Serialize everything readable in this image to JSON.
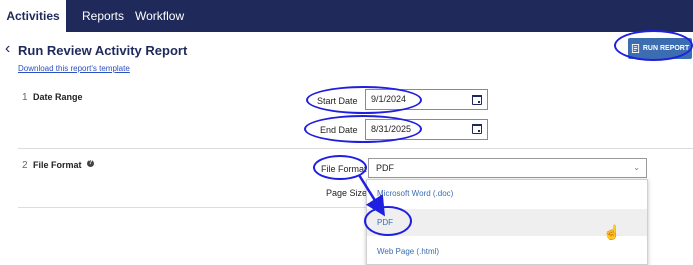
{
  "topnav": {
    "tabs": [
      "Activities",
      "Reports",
      "Workflow"
    ]
  },
  "header": {
    "title": "Run Review Activity Report",
    "template_link": "Download this report's template",
    "run_button": "RUN REPORT"
  },
  "steps": [
    {
      "number": "1",
      "label": "Date Range"
    },
    {
      "number": "2",
      "label": "File Format"
    }
  ],
  "date_range": {
    "start_label": "Start Date",
    "start_value": "9/1/2024",
    "end_label": "End Date",
    "end_value": "8/31/2025"
  },
  "file_format": {
    "label": "File Format",
    "value": "PDF",
    "page_size_label": "Page Size",
    "options": [
      "Microsoft Word (.doc)",
      "PDF",
      "Web Page (.html)"
    ],
    "selected_index": 1
  },
  "colors": {
    "nav": "#1f2a5b",
    "accent": "#3c6db1",
    "annotation": "#1f1fe0"
  }
}
